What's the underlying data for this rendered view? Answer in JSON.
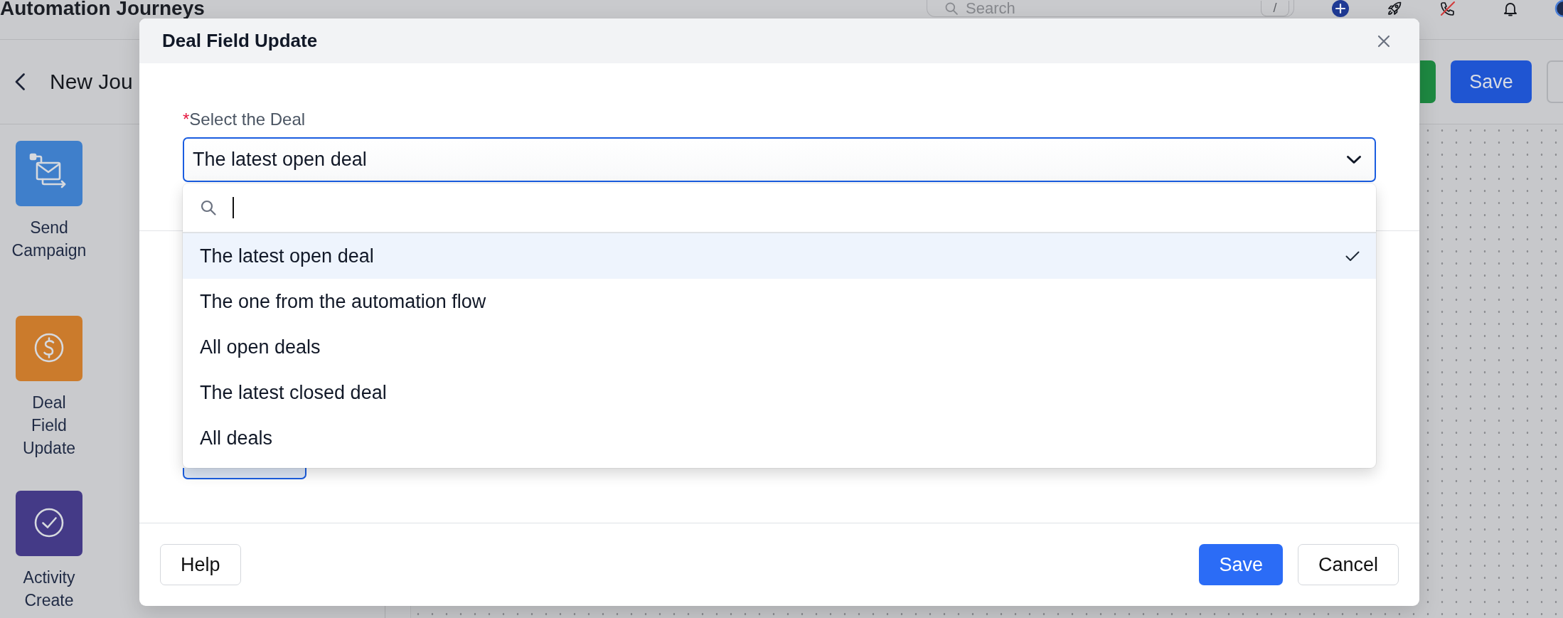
{
  "app_header": {
    "title": "Automation Journeys",
    "search": {
      "placeholder": "Search",
      "shortcut": "/"
    }
  },
  "toolbar": {
    "title": "New Jou",
    "buttons": [
      {
        "kind": "success"
      },
      {
        "kind": "primary",
        "label": "Save"
      },
      {
        "kind": "outline"
      }
    ]
  },
  "palette": [
    {
      "kind": "campaign",
      "label": "Send Campaign",
      "color": "#3f7fcb"
    },
    {
      "kind": "deal",
      "label": "Deal Field Update",
      "color": "#cb7b2c"
    },
    {
      "kind": "activity",
      "label": "Activity Create",
      "color": "#443a87"
    }
  ],
  "dialog": {
    "title": "Deal Field Update",
    "field": {
      "required_mark": "*",
      "label": "Select the Deal",
      "value": "The latest open deal",
      "open": true,
      "search": {
        "focused": true
      },
      "options": [
        {
          "label": "The latest open deal",
          "selected": true
        },
        {
          "label": "The one from the automation flow",
          "selected": false
        },
        {
          "label": "All open deals",
          "selected": false
        },
        {
          "label": "The latest closed deal",
          "selected": false
        },
        {
          "label": "All deals",
          "selected": false
        }
      ]
    },
    "covered_button": {
      "kind": "tinted"
    },
    "footer": {
      "left_buttons": [
        {
          "label": "Help",
          "kind": "secondary"
        }
      ],
      "right_buttons": [
        {
          "label": "Save",
          "kind": "primary"
        },
        {
          "label": "Cancel",
          "kind": "secondary"
        }
      ]
    }
  }
}
